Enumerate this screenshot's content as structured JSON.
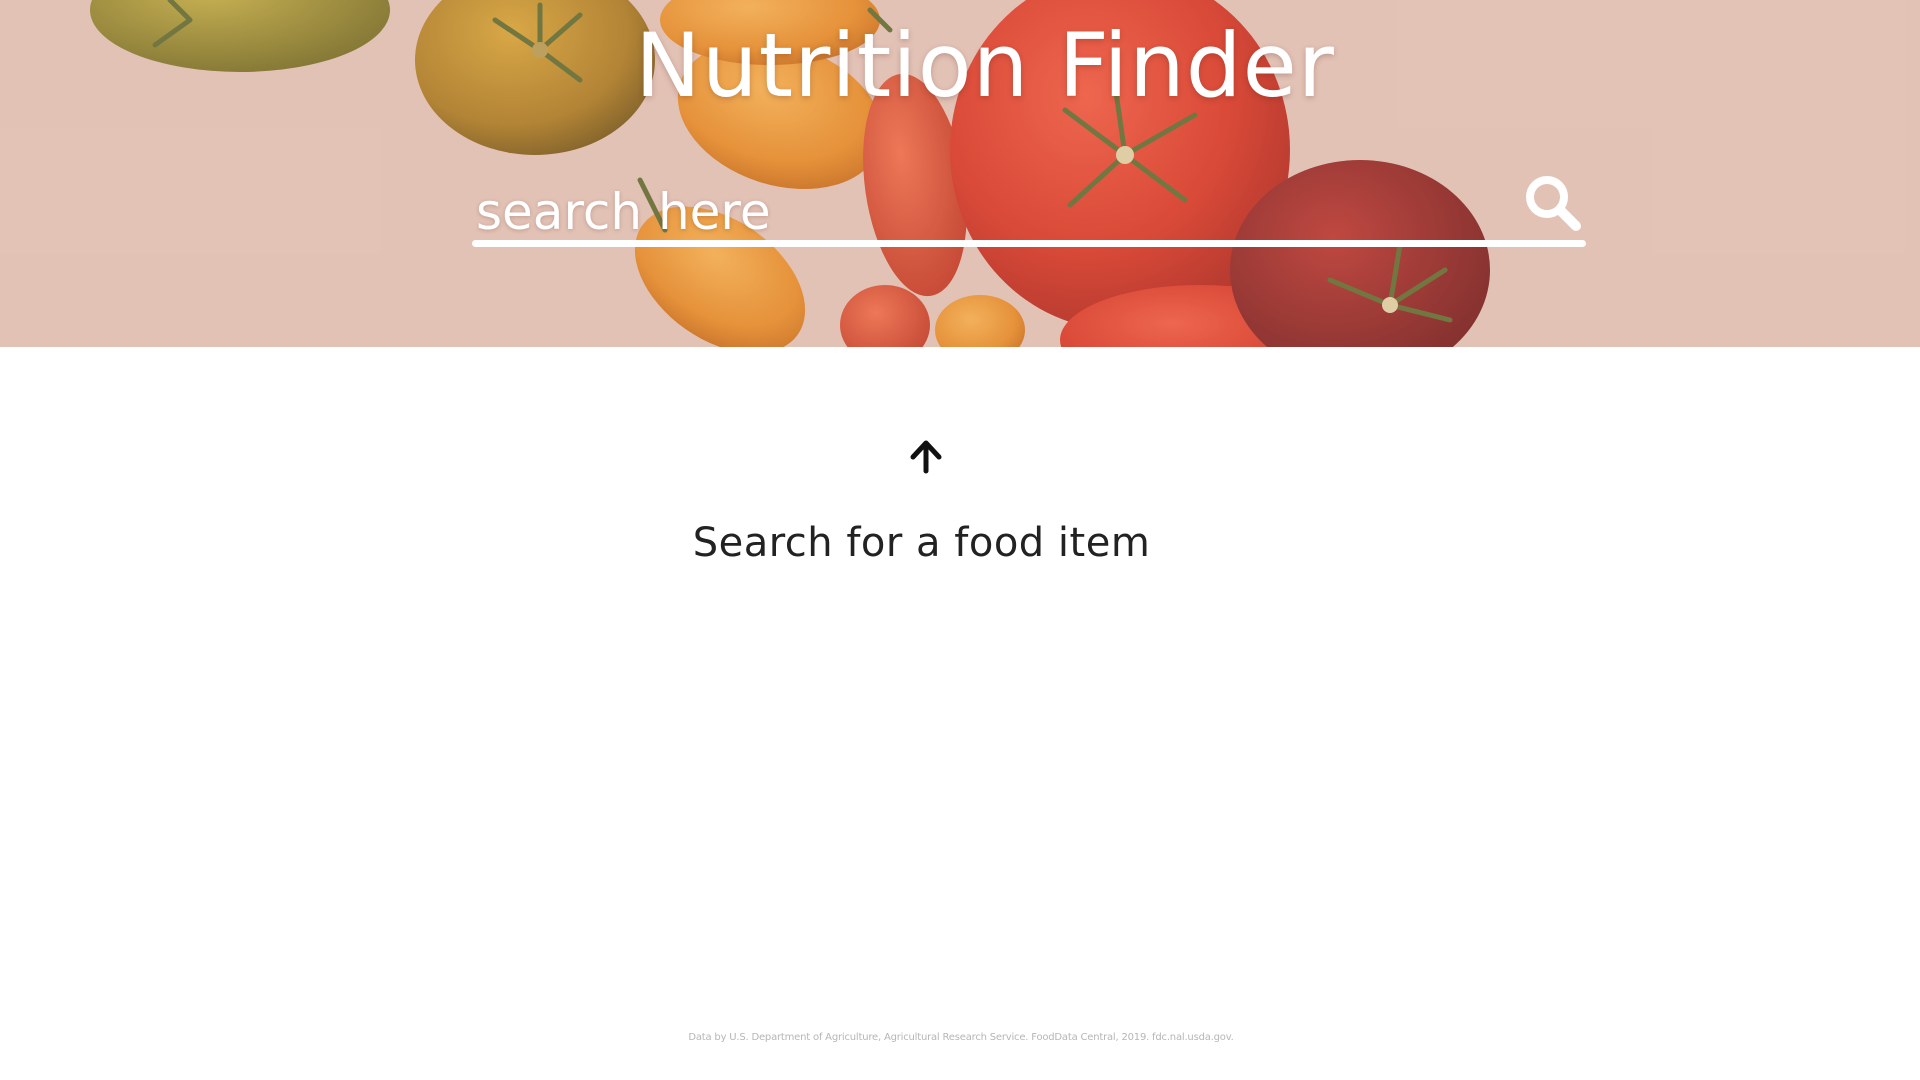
{
  "header": {
    "title": "Nutrition Finder"
  },
  "search": {
    "placeholder": "search here",
    "value": "",
    "button_icon": "search-icon"
  },
  "main": {
    "hint_icon": "arrow-up-icon",
    "hint_text": "Search for a food item"
  },
  "footer": {
    "credit": "Data by U.S. Department of Agriculture, Agricultural Research Service. FoodData Central, 2019. fdc.nal.usda.gov."
  },
  "colors": {
    "hero_background": "#e2c4b8",
    "title_text": "#ffffff",
    "body_text": "#222222",
    "footer_text": "#b6b6b6"
  }
}
